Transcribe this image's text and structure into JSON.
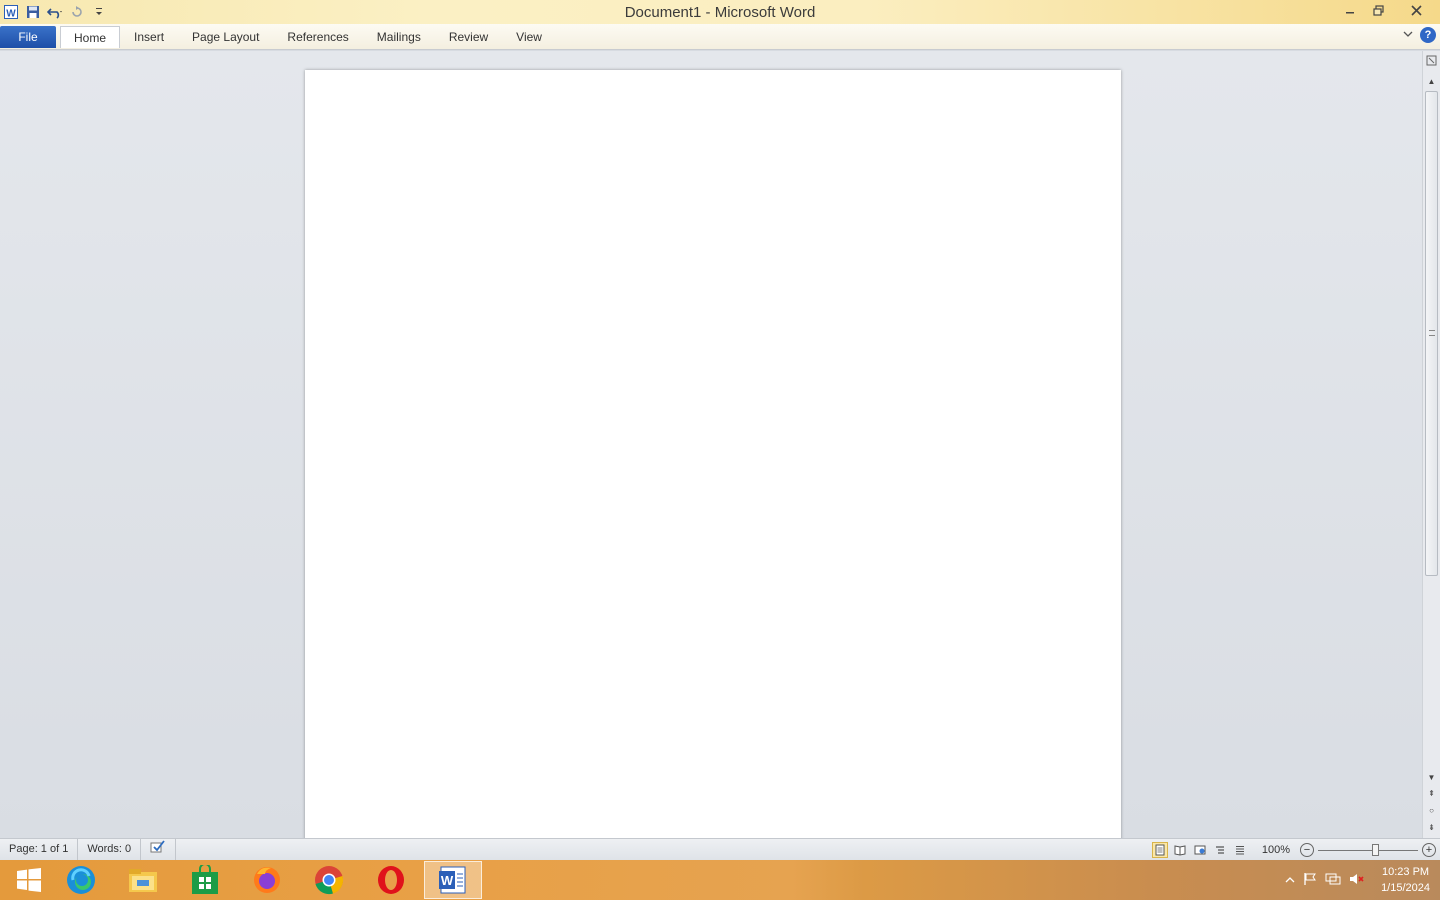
{
  "window": {
    "title": "Document1  -  Microsoft Word"
  },
  "ribbon": {
    "tabs": [
      "File",
      "Home",
      "Insert",
      "Page Layout",
      "References",
      "Mailings",
      "Review",
      "View"
    ]
  },
  "statusbar": {
    "page": "Page: 1 of 1",
    "words": "Words: 0",
    "zoom": "100%",
    "zoom_level": 1.0
  },
  "taskbar": {
    "apps": [
      "start",
      "edge",
      "file-explorer",
      "store",
      "firefox",
      "chrome",
      "opera",
      "word"
    ],
    "active": "word",
    "time": "10:23 PM",
    "date": "1/15/2024"
  },
  "colors": {
    "file_tab": "#2b5fb8",
    "titlebar": "#f7e8b0",
    "taskbar": "#e49a3c"
  }
}
